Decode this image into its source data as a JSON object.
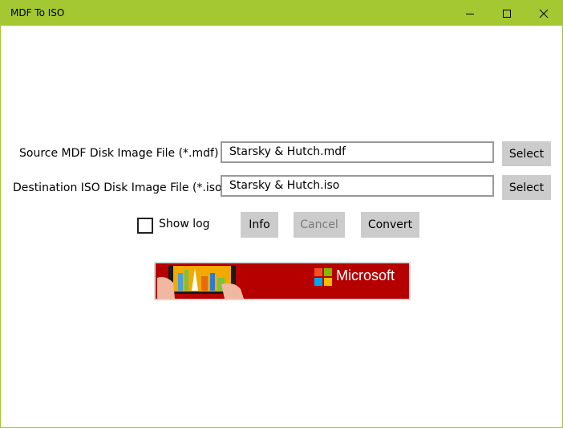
{
  "window": {
    "title": "MDF To ISO"
  },
  "controls": {
    "minimize": "minimize",
    "maximize": "maximize",
    "close": "close"
  },
  "source": {
    "label": "Source MDF Disk Image File (*.mdf)",
    "value": "Starsky & Hutch.mdf",
    "select_label": "Select"
  },
  "destination": {
    "label": "Destination ISO Disk Image File (*.iso)",
    "value": "Starsky & Hutch.iso",
    "select_label": "Select"
  },
  "options": {
    "show_log_label": "Show log",
    "show_log_checked": false
  },
  "actions": {
    "info_label": "Info",
    "cancel_label": "Cancel",
    "convert_label": "Convert"
  },
  "ad": {
    "brand_text": "Microsoft"
  },
  "colors": {
    "accent": "#a4c832",
    "button": "#cccccc",
    "ad_background": "#b60000"
  }
}
